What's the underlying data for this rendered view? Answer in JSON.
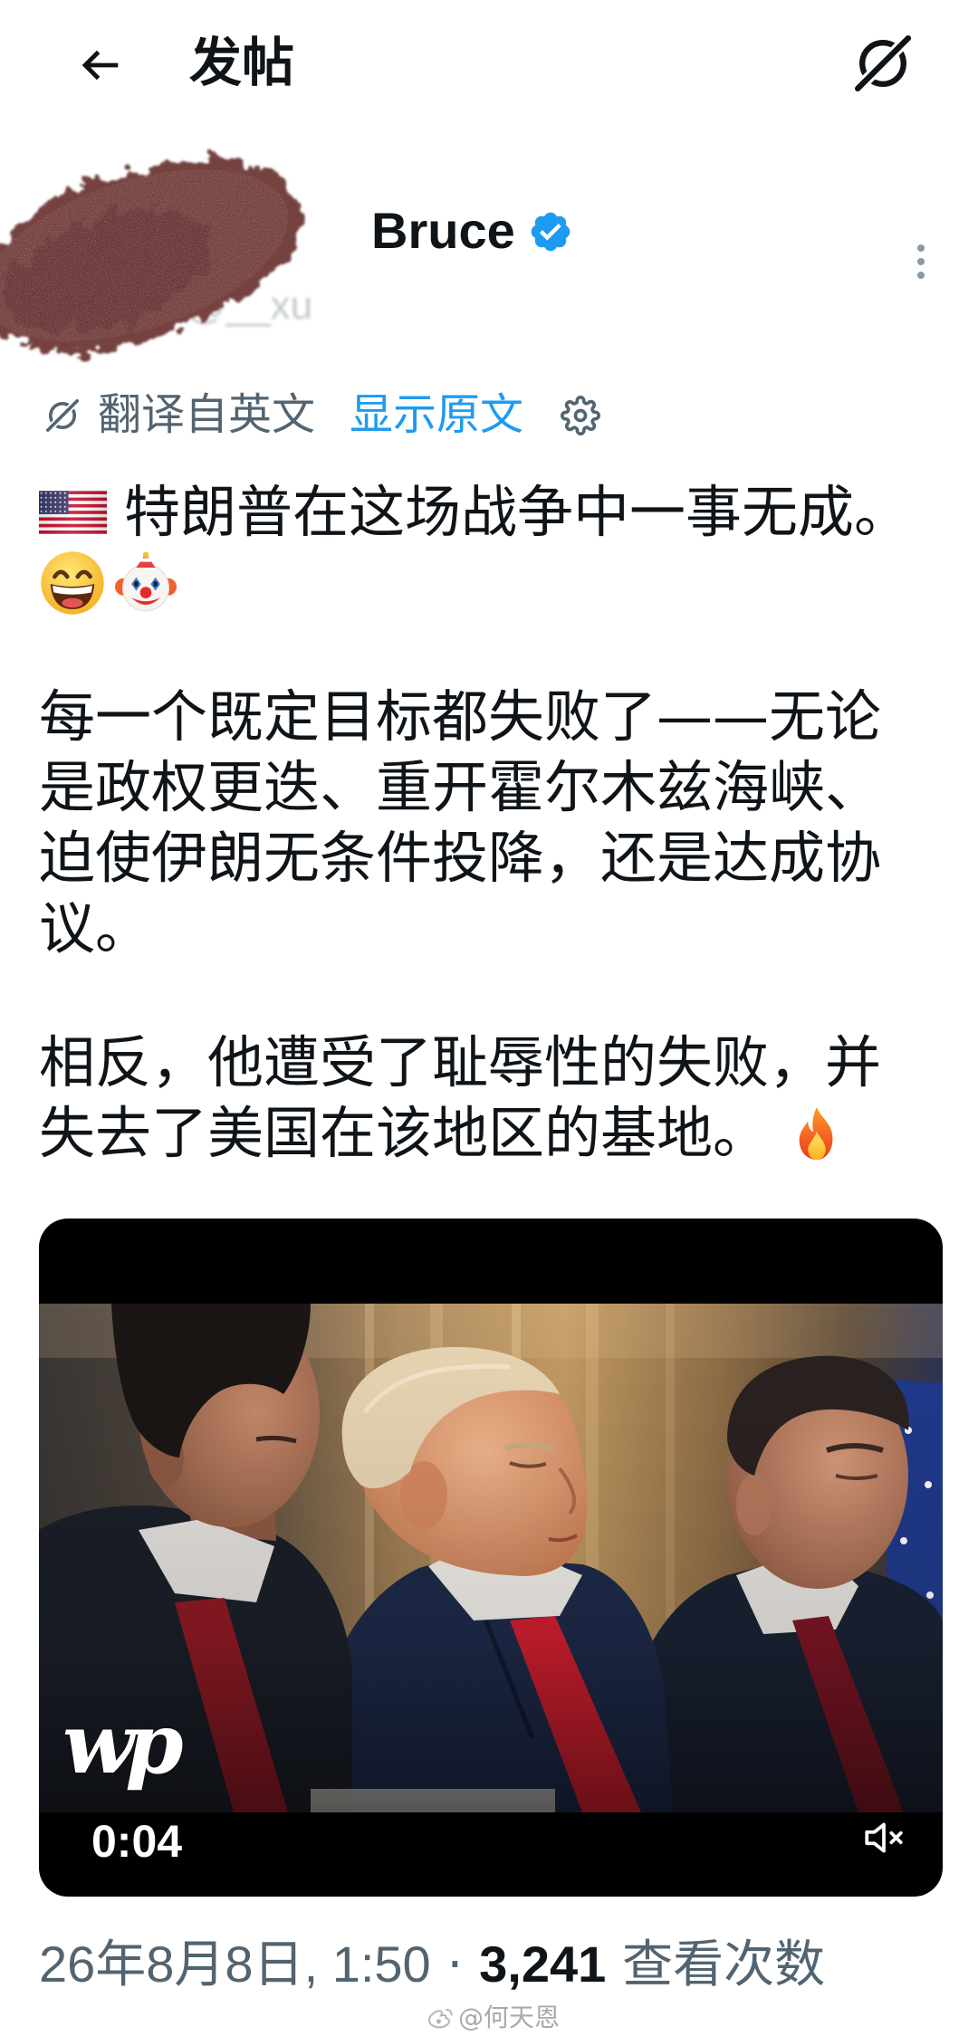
{
  "header": {
    "title": "发帖",
    "back_icon": "back-arrow-icon",
    "action_icon": "grok-icon"
  },
  "author": {
    "name": "Bruce",
    "handle": "@__xu",
    "verified_icon": "verified-badge-icon",
    "more_icon": "more-vertical-icon"
  },
  "translation": {
    "icon": "translate-icon",
    "label": "翻译自英文",
    "show_original": "显示原文",
    "settings_icon": "gear-icon"
  },
  "post": {
    "paragraphs": [
      {
        "lines": [
          {
            "leading_emoji": "us-flag-emoji",
            "text": "特朗普在这场战争中一事无成。"
          },
          {
            "emojis": [
              "grinning-face-emoji",
              "clown-face-emoji"
            ]
          }
        ]
      },
      {
        "lines": [
          {
            "text": "每一个既定目标都失败了——无论"
          },
          {
            "text": "是政权更迭、重开霍尔木兹海峡、"
          },
          {
            "text": "迫使伊朗无条件投降，还是达成协"
          },
          {
            "text": "议。"
          }
        ]
      },
      {
        "lines": [
          {
            "text": "相反，他遭受了耻辱性的失败，并"
          },
          {
            "text": "失去了美国在该地区的基地。",
            "trailing_emoji": "fire-emoji"
          }
        ]
      }
    ]
  },
  "video": {
    "logo": "wp",
    "duration": "0:04",
    "mute_icon": "volume-muted-icon"
  },
  "meta": {
    "date": "26年8月8日, 1:50",
    "separator": "·",
    "views": "3,241",
    "views_label": "查看次数"
  },
  "watermark": {
    "icon": "weibo-icon",
    "text": "@何天恩"
  },
  "colors": {
    "text": "#0f1419",
    "secondary": "#536471",
    "accent": "#1d9bf0",
    "background": "#ffffff",
    "video_background": "#000000",
    "redaction": "#744240"
  }
}
